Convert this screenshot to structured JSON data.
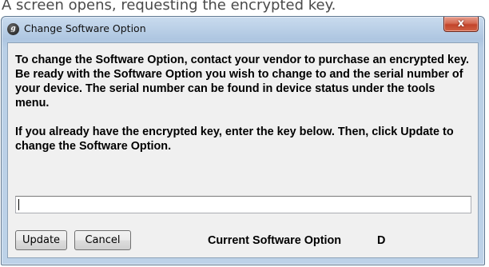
{
  "caption": "A screen opens, requesting the encrypted key.",
  "window": {
    "title": "Change Software Option",
    "icon": "ge-logo-icon",
    "close_label": "x"
  },
  "message": {
    "paragraph1": "To change the Software Option, contact your vendor to purchase an encrypted key.  Be ready with the Software Option you wish to change to and the serial number of your device.  The serial number can be found in device status under the tools menu.",
    "paragraph2": "If you already have the encrypted key, enter the key below. Then, click Update to change the Software Option."
  },
  "key_input": {
    "value": ""
  },
  "buttons": {
    "update_label": "Update",
    "cancel_label": "Cancel"
  },
  "current_option": {
    "label": "Current Software Option",
    "value": "D"
  },
  "colors": {
    "title_bar": "#b9cfe6",
    "close_button": "#c2442a",
    "client_bg": "#f0f0f0"
  }
}
